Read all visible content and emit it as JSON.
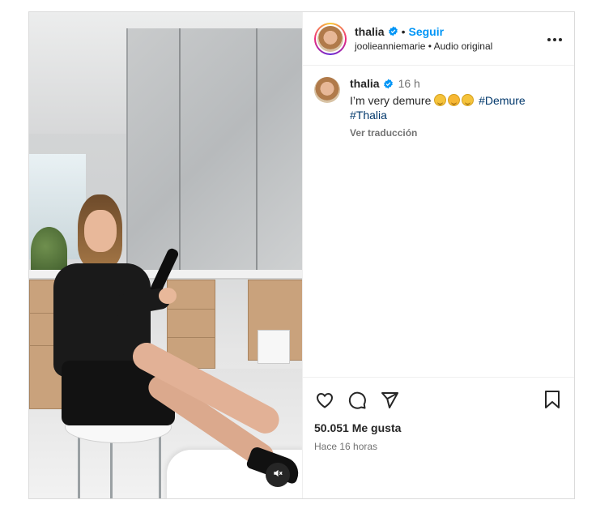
{
  "post": {
    "author": {
      "username": "thalia",
      "follow_label": "Seguir",
      "dot": "•",
      "audio_info": "joolieanniemarie • Audio original",
      "more_icon": "more-horizontal-icon"
    },
    "caption": {
      "username": "thalia",
      "time": "16 h",
      "text": "I’m very demure",
      "emojis": [
        "smiling-face-emoji",
        "smiling-hearts-emoji",
        "smiling-face-emoji"
      ],
      "hashtag_1": "#Demure",
      "hashtag_2": "#Thalia",
      "translate_label": "Ver traducción"
    },
    "actions": {
      "icons": [
        "heart-icon",
        "comment-icon",
        "share-icon",
        "bookmark-icon"
      ],
      "likes": "50.051 Me gusta",
      "posted_ago": "Hace 16 horas"
    },
    "media": {
      "mute_icon": "speaker-muted-icon"
    },
    "colors": {
      "accent": "#0095f6",
      "hashtag": "#00376b",
      "verified": "#0095f6"
    }
  }
}
